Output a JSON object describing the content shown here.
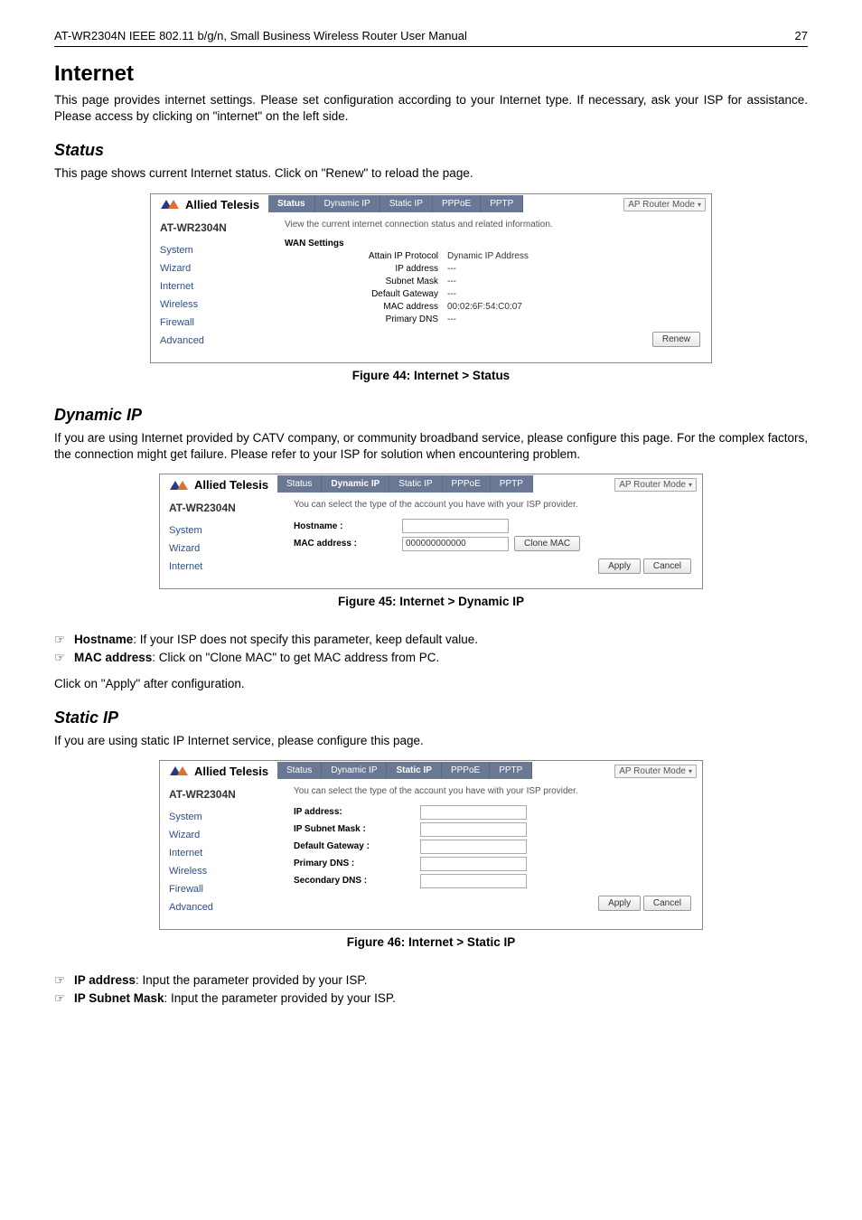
{
  "header": {
    "left": "AT-WR2304N IEEE 802.11 b/g/n, Small Business Wireless Router User Manual",
    "right": "27"
  },
  "internet": {
    "title": "Internet",
    "intro": "This page provides internet settings. Please set configuration according to your Internet type. If necessary, ask your ISP for assistance. Please access by clicking on \"internet\" on the left side."
  },
  "status": {
    "title": "Status",
    "intro": "This page shows current Internet status. Click on \"Renew\" to reload the page.",
    "figcaption": "Figure 44: Internet > Status"
  },
  "router": {
    "logo": "Allied Telesis",
    "mode": "AP Router Mode",
    "model": "AT-WR2304N",
    "tabs": {
      "status": "Status",
      "dyn": "Dynamic IP",
      "static": "Static IP",
      "pppoe": "PPPoE",
      "pptp": "PPTP"
    },
    "nav": {
      "system": "System",
      "wizard": "Wizard",
      "internet": "Internet",
      "wireless": "Wireless",
      "firewall": "Firewall",
      "advanced": "Advanced"
    },
    "status_screen": {
      "hint": "View the current internet connection status and related information.",
      "section": "WAN Settings",
      "rows": {
        "proto_k": "Attain IP Protocol",
        "proto_v": "Dynamic IP Address",
        "ip_k": "IP address",
        "ip_v": "---",
        "mask_k": "Subnet Mask",
        "mask_v": "---",
        "gw_k": "Default Gateway",
        "gw_v": "---",
        "mac_k": "MAC address",
        "mac_v": "00:02:6F:54:C0:07",
        "dns_k": "Primary DNS",
        "dns_v": "---"
      },
      "renew": "Renew"
    },
    "dyn_screen": {
      "hint": "You can select the type of the account you have with your ISP provider.",
      "host_k": "Hostname :",
      "mac_k": "MAC address :",
      "mac_v": "000000000000",
      "clone": "Clone MAC",
      "apply": "Apply",
      "cancel": "Cancel"
    },
    "static_screen": {
      "hint": "You can select the type of the account you have with your ISP provider.",
      "ip_k": "IP address:",
      "mask_k": "IP Subnet Mask :",
      "gw_k": "Default Gateway :",
      "pdns_k": "Primary DNS :",
      "sdns_k": "Secondary DNS :",
      "apply": "Apply",
      "cancel": "Cancel"
    }
  },
  "dynamic": {
    "title": "Dynamic IP",
    "intro": "If you are using Internet provided by CATV company, or community broadband service, please configure this page. For the complex factors, the connection might get failure. Please refer to your ISP for solution when encountering problem.",
    "figcaption": "Figure 45: Internet > Dynamic IP",
    "b1_strong": "Hostname",
    "b1_rest": ": If your ISP does not specify this parameter, keep default value.",
    "b2_strong": "MAC address",
    "b2_rest": ": Click on \"Clone MAC\" to get MAC address from PC.",
    "tail": "Click on \"Apply\" after configuration."
  },
  "staticip": {
    "title": "Static IP",
    "intro": "If you are using static IP Internet service, please configure this page.",
    "figcaption": "Figure 46: Internet > Static IP",
    "b1_strong": "IP address",
    "b1_rest": ": Input the parameter provided by your ISP.",
    "b2_strong": "IP Subnet Mask",
    "b2_rest": ": Input the parameter provided by your ISP."
  }
}
